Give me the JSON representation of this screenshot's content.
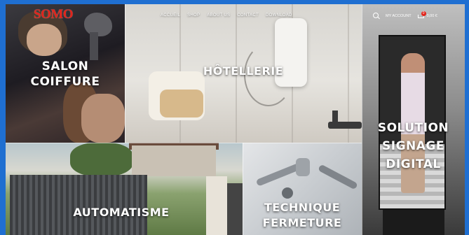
{
  "header": {
    "logo": "SOMO",
    "nav": [
      "ACCUEIL",
      "SHOP",
      "ABOUT US",
      "CONTACT",
      "DOWNLOAD"
    ],
    "account_label": "MY ACCOUNT",
    "cart_count": "0",
    "cart_total": "0,00 €"
  },
  "tiles": {
    "salon": "SALON COIFFURE",
    "hotel": "HÔTELLERIE",
    "signage": "SOLUTION SIGNAGE DIGITAL",
    "auto": "AUTOMATISME",
    "ferm": "TECHNIQUE FERMETURE"
  },
  "colors": {
    "brand": "#e2231a",
    "frame": "#1f6fd1"
  }
}
